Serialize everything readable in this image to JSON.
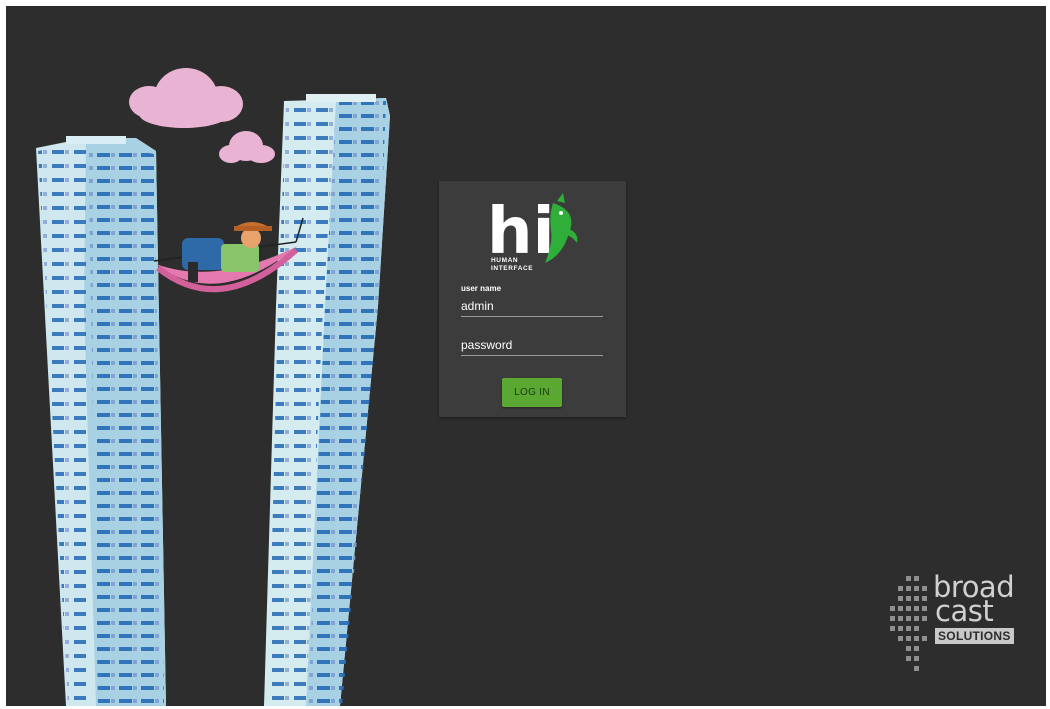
{
  "app": {
    "logo_text": "hi",
    "logo_subtitle_line1": "HUMAN",
    "logo_subtitle_line2": "INTERFACE"
  },
  "login": {
    "username_label": "user name",
    "username_value": "admin",
    "password_placeholder": "password",
    "submit_label": "LOG IN"
  },
  "brand": {
    "word1": "broad",
    "word2": "cast",
    "badge": "SOLUTIONS"
  },
  "colors": {
    "background": "#2d2d2d",
    "panel": "#3c3c3c",
    "accent_green": "#5aa832"
  }
}
